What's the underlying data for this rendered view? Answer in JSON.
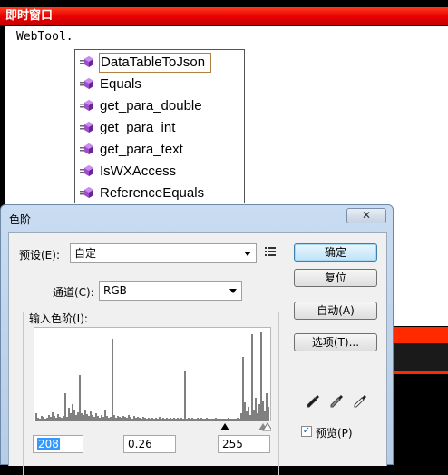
{
  "immediate_window": {
    "title": "即时窗口",
    "code_line": "WebTool."
  },
  "intellisense": {
    "items": [
      {
        "label": "DataTableToJson",
        "selected": true
      },
      {
        "label": "Equals",
        "selected": false
      },
      {
        "label": "get_para_double",
        "selected": false
      },
      {
        "label": "get_para_int",
        "selected": false
      },
      {
        "label": "get_para_text",
        "selected": false
      },
      {
        "label": "IsWXAccess",
        "selected": false
      },
      {
        "label": "ReferenceEquals",
        "selected": false
      }
    ],
    "item_icon": "method-cube-icon"
  },
  "levels_dialog": {
    "title": "色阶",
    "close_symbol": "✕",
    "preset_label": "预设(E):",
    "preset_value": "自定",
    "channel_label": "通道(C):",
    "channel_value": "RGB",
    "input_levels_label": "输入色阶(I):",
    "input_black": "208",
    "input_gamma": "0.26",
    "input_white": "255",
    "buttons": {
      "ok": "确定",
      "reset": "复位",
      "auto": "自动(A)",
      "options": "选项(T)..."
    },
    "preview_label": "预览(P)",
    "preview_checked": true,
    "histogram_bars": [
      [
        2,
        8
      ],
      [
        4,
        3
      ],
      [
        6,
        2
      ],
      [
        8,
        5
      ],
      [
        10,
        4
      ],
      [
        12,
        2
      ],
      [
        14,
        3
      ],
      [
        16,
        6
      ],
      [
        18,
        4
      ],
      [
        20,
        9
      ],
      [
        22,
        5
      ],
      [
        24,
        3
      ],
      [
        26,
        7
      ],
      [
        28,
        4
      ],
      [
        30,
        3
      ],
      [
        32,
        5
      ],
      [
        34,
        30
      ],
      [
        36,
        4
      ],
      [
        38,
        14
      ],
      [
        40,
        8
      ],
      [
        42,
        18
      ],
      [
        44,
        12
      ],
      [
        46,
        6
      ],
      [
        48,
        9
      ],
      [
        50,
        50
      ],
      [
        52,
        8
      ],
      [
        54,
        6
      ],
      [
        56,
        12
      ],
      [
        58,
        7
      ],
      [
        60,
        5
      ],
      [
        62,
        10
      ],
      [
        64,
        6
      ],
      [
        66,
        4
      ],
      [
        68,
        8
      ],
      [
        70,
        5
      ],
      [
        72,
        3
      ],
      [
        74,
        6
      ],
      [
        76,
        4
      ],
      [
        78,
        12
      ],
      [
        80,
        5
      ],
      [
        82,
        3
      ],
      [
        84,
        4
      ],
      [
        86,
        90
      ],
      [
        88,
        6
      ],
      [
        90,
        3
      ],
      [
        92,
        5
      ],
      [
        94,
        4
      ],
      [
        96,
        3
      ],
      [
        98,
        5
      ],
      [
        100,
        4
      ],
      [
        102,
        3
      ],
      [
        104,
        6
      ],
      [
        106,
        4
      ],
      [
        108,
        2
      ],
      [
        110,
        5
      ],
      [
        112,
        3
      ],
      [
        114,
        4
      ],
      [
        116,
        3
      ],
      [
        118,
        2
      ],
      [
        120,
        4
      ],
      [
        122,
        3
      ],
      [
        124,
        2
      ],
      [
        126,
        3
      ],
      [
        128,
        2
      ],
      [
        130,
        3
      ],
      [
        132,
        2
      ],
      [
        134,
        3
      ],
      [
        136,
        2
      ],
      [
        138,
        4
      ],
      [
        140,
        2
      ],
      [
        142,
        3
      ],
      [
        144,
        2
      ],
      [
        146,
        3
      ],
      [
        148,
        2
      ],
      [
        150,
        3
      ],
      [
        152,
        2
      ],
      [
        154,
        3
      ],
      [
        156,
        2
      ],
      [
        158,
        3
      ],
      [
        160,
        2
      ],
      [
        162,
        3
      ],
      [
        164,
        2
      ],
      [
        166,
        55
      ],
      [
        168,
        2
      ],
      [
        170,
        3
      ],
      [
        172,
        2
      ],
      [
        174,
        3
      ],
      [
        176,
        2
      ],
      [
        178,
        2
      ],
      [
        180,
        3
      ],
      [
        182,
        2
      ],
      [
        184,
        3
      ],
      [
        186,
        2
      ],
      [
        188,
        2
      ],
      [
        190,
        3
      ],
      [
        192,
        2
      ],
      [
        194,
        2
      ],
      [
        196,
        2
      ],
      [
        198,
        2
      ],
      [
        200,
        3
      ],
      [
        202,
        2
      ],
      [
        204,
        2
      ],
      [
        206,
        2
      ],
      [
        208,
        2
      ],
      [
        210,
        2
      ],
      [
        212,
        2
      ],
      [
        214,
        3
      ],
      [
        216,
        2
      ],
      [
        218,
        2
      ],
      [
        220,
        2
      ],
      [
        222,
        2
      ],
      [
        224,
        3
      ],
      [
        226,
        2
      ],
      [
        228,
        8
      ],
      [
        230,
        70
      ],
      [
        232,
        20
      ],
      [
        234,
        10
      ],
      [
        236,
        15
      ],
      [
        238,
        6
      ],
      [
        240,
        95
      ],
      [
        242,
        12
      ],
      [
        244,
        25
      ],
      [
        246,
        8
      ],
      [
        248,
        18
      ],
      [
        250,
        98
      ],
      [
        252,
        22
      ],
      [
        254,
        10
      ],
      [
        256,
        30
      ],
      [
        258,
        15
      ]
    ]
  }
}
